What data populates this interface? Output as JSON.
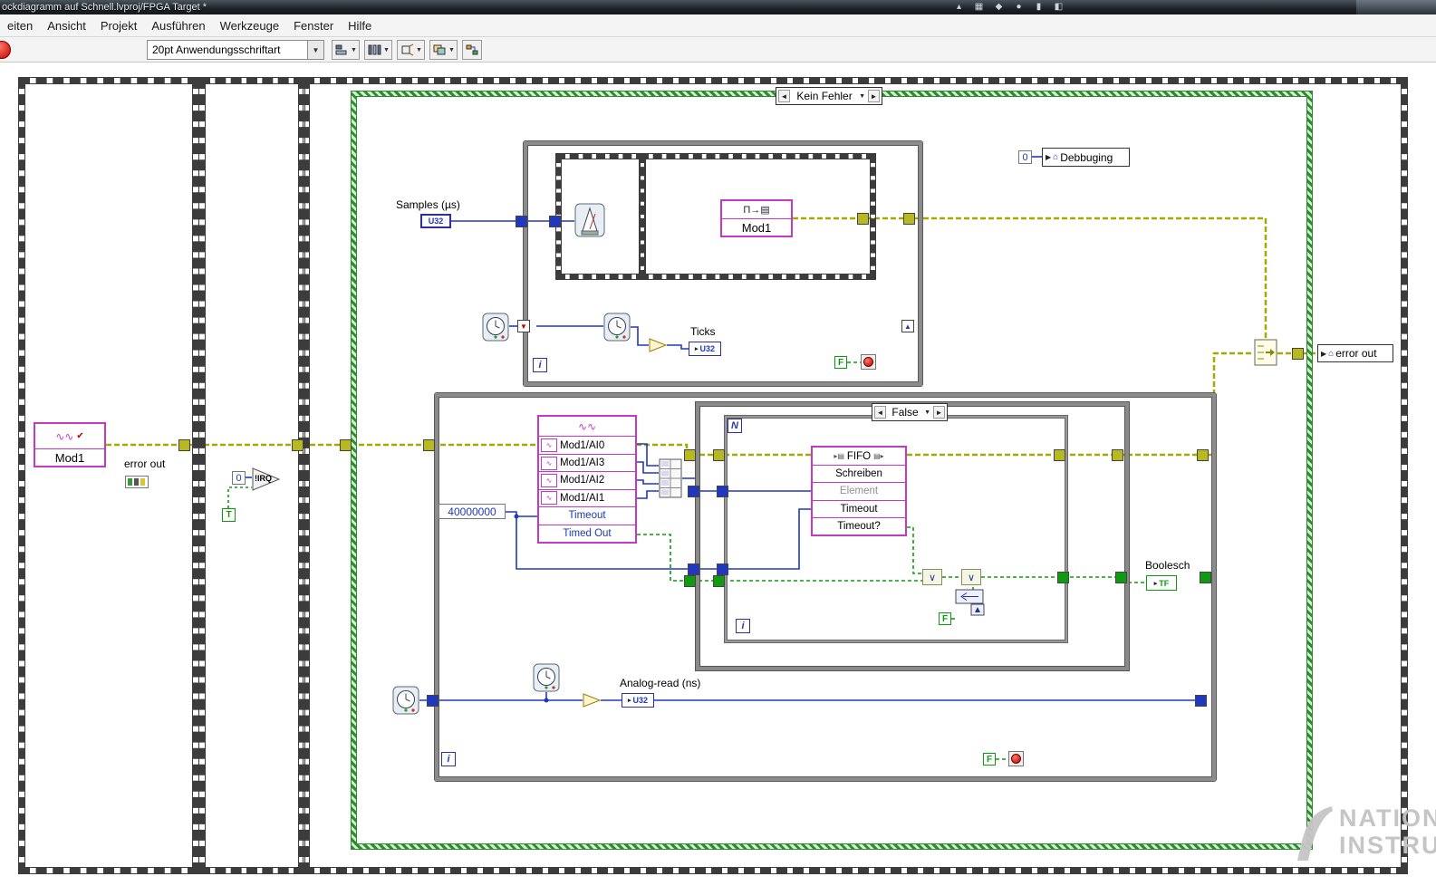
{
  "window": {
    "title": "ockdiagramm auf Schnell.lvproj/FPGA Target *"
  },
  "menu": {
    "items": [
      "eiten",
      "Ansicht",
      "Projekt",
      "Ausführen",
      "Werkzeuge",
      "Fenster",
      "Hilfe"
    ]
  },
  "toolbar": {
    "font_selector": "20pt Anwendungsschriftart"
  },
  "icons": {
    "case_prev": "◄",
    "case_next": "►",
    "dropdown": "▼",
    "up_arrow": "▲",
    "down_arrow": "▼",
    "indicator_arrow": "▶",
    "host": "⌂",
    "terminal_arrow": "▸",
    "waveform": "∿∿",
    "waveform_small": "∿",
    "check": "✔",
    "seq_mod1": "Π→▤",
    "or": "∨",
    "fifo_in": "▸▤",
    "fifo_out": "▤▸"
  },
  "diagram": {
    "frame1": {
      "mod1_label": "Mod1",
      "error_out_label": "error out"
    },
    "frame2": {
      "irq_const": "0",
      "irq_label": "!IRQ",
      "bool_const": "T"
    },
    "case_no_error": {
      "selector": "Kein Fehler",
      "debug_const": "0",
      "debug_label": "Debbuging",
      "samples_label": "Samples (µs)",
      "samples_type": "U32",
      "seq_mod1_label": "Mod1",
      "timing_loop": {
        "ticks_label": "Ticks",
        "ticks_type": "U32",
        "iterator": "i",
        "stop_const": "F"
      },
      "acq_loop": {
        "timeout_const": "40000000",
        "io_channels": [
          "Mod1/AI0",
          "Mod1/AI3",
          "Mod1/AI2",
          "Mod1/AI1"
        ],
        "io_timeout": "Timeout",
        "io_timed_out": "Timed Out",
        "case_false": {
          "selector": "False",
          "count_terminal": "N",
          "fifo_title": "FIFO",
          "fifo_method": "Schreiben",
          "fifo_element": "Element",
          "fifo_timeout": "Timeout",
          "fifo_timeout_q": "Timeout?",
          "f_const": "F",
          "iterator": "i"
        },
        "boolesch_label": "Boolesch",
        "boolesch_type": "TF",
        "analog_label": "Analog-read (ns)",
        "analog_type": "U32",
        "iterator": "i",
        "stop_const": "F"
      },
      "error_out_label": "error out"
    },
    "watermark": {
      "line1": "NATION",
      "line2": "INSTRU"
    }
  }
}
